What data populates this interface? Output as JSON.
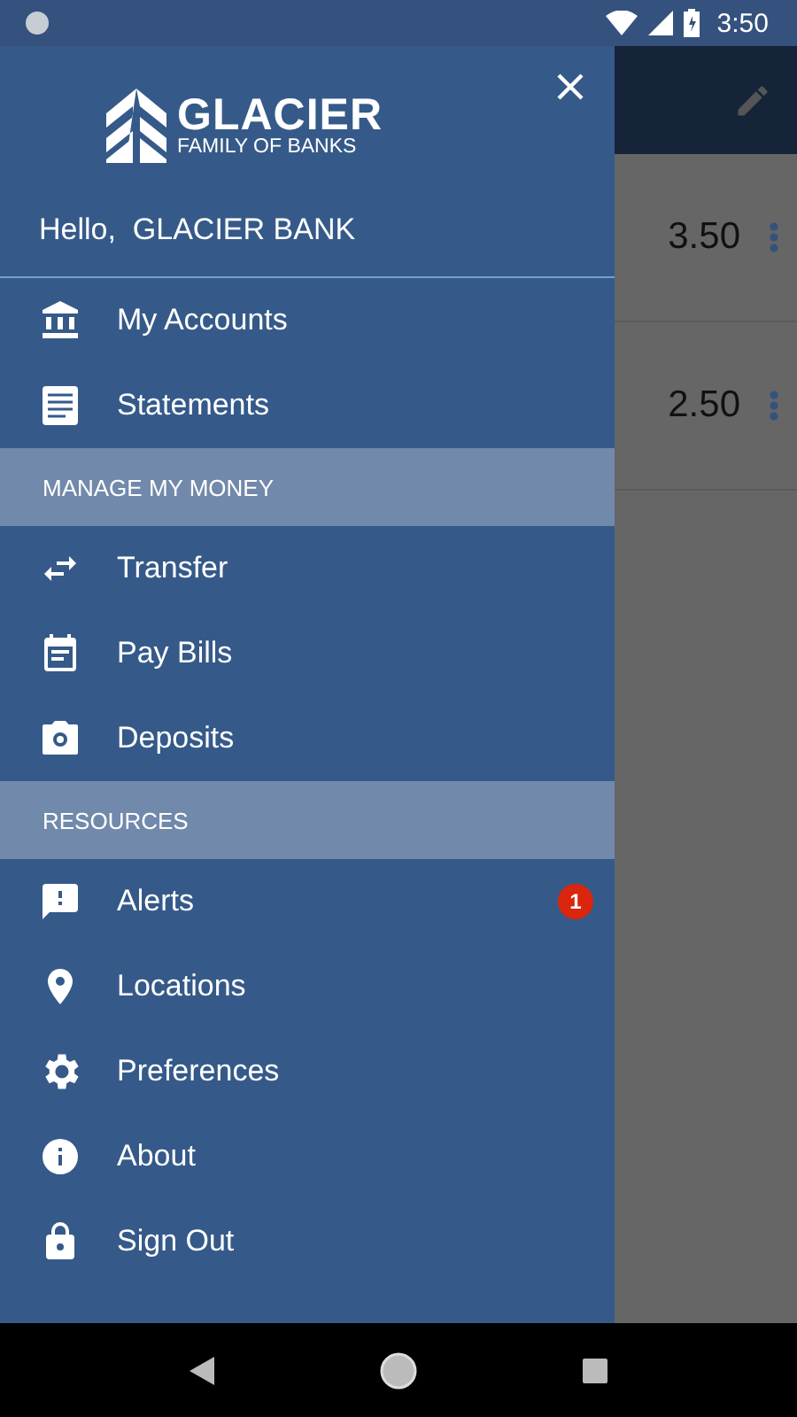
{
  "status_bar": {
    "time": "3:50"
  },
  "background": {
    "rows": [
      {
        "amount": "3.50"
      },
      {
        "amount": "2.50"
      }
    ]
  },
  "drawer": {
    "logo": {
      "name": "GLACIER",
      "tagline": "FAMILY OF BANKS"
    },
    "greeting": "Hello,  GLACIER BANK",
    "groups": [
      {
        "items": [
          {
            "label": "My Accounts",
            "kind": "bank"
          },
          {
            "label": "Statements",
            "kind": "document"
          }
        ]
      },
      {
        "header": "MANAGE MY MONEY",
        "items": [
          {
            "label": "Transfer",
            "kind": "transfer"
          },
          {
            "label": "Pay Bills",
            "kind": "calendar"
          },
          {
            "label": "Deposits",
            "kind": "camera"
          }
        ]
      },
      {
        "header": "RESOURCES",
        "items": [
          {
            "label": "Alerts",
            "kind": "alert",
            "badge": "1"
          },
          {
            "label": "Locations",
            "kind": "pin"
          },
          {
            "label": "Preferences",
            "kind": "gear"
          },
          {
            "label": "About",
            "kind": "info"
          },
          {
            "label": "Sign Out",
            "kind": "lock"
          }
        ]
      }
    ]
  }
}
